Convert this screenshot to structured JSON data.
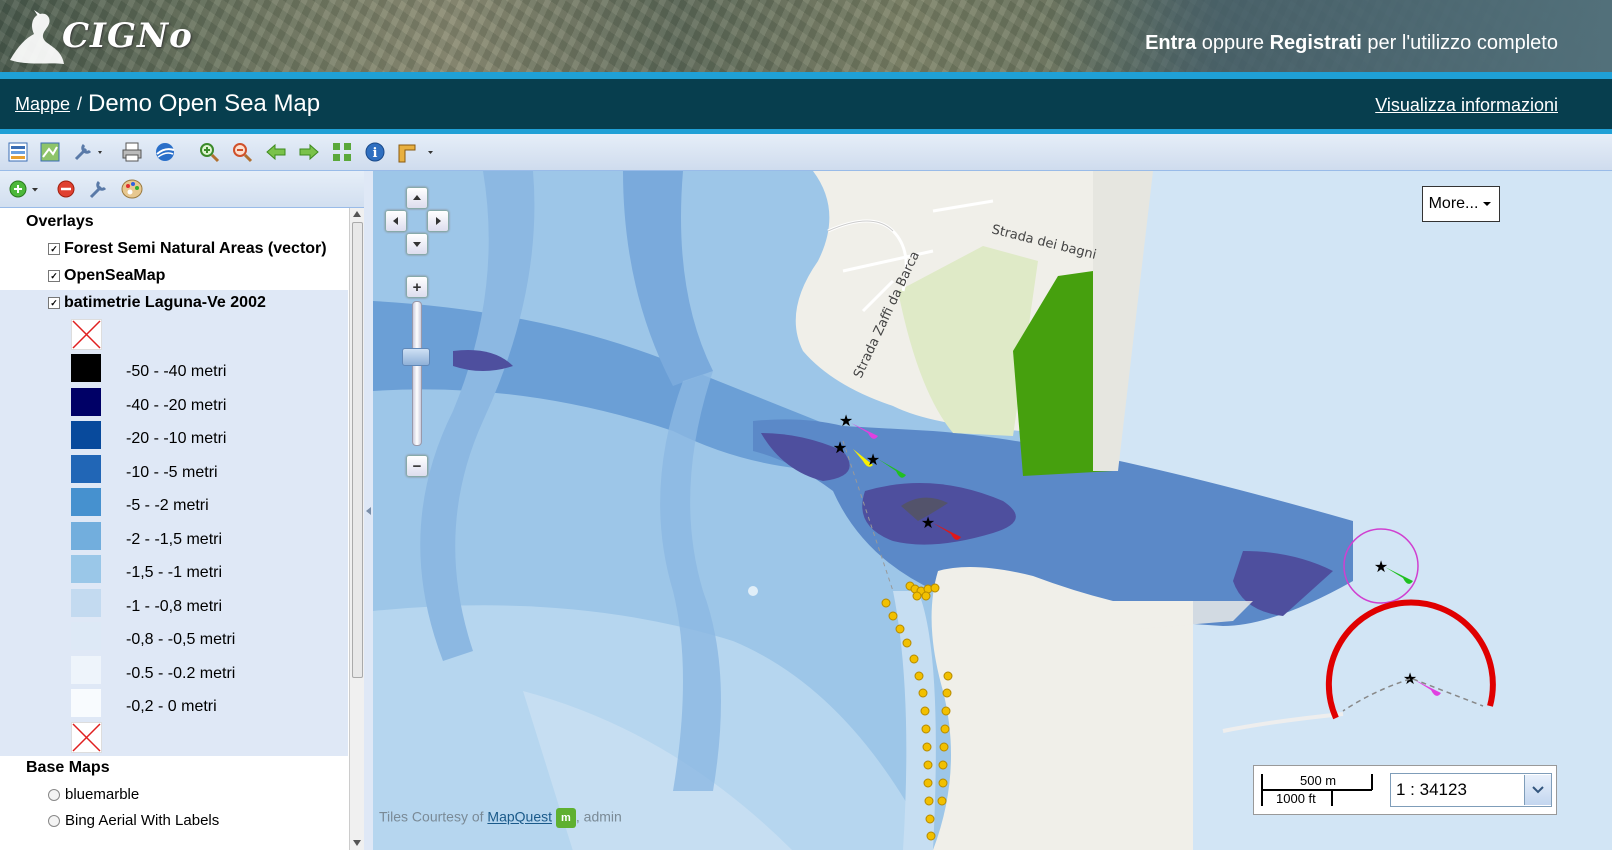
{
  "header": {
    "logo_text": "CIGNo",
    "auth_login": "Entra",
    "auth_or": "oppure",
    "auth_register": "Registrati",
    "auth_suffix": "per l'utilizzo completo"
  },
  "titlebar": {
    "breadcrumb_link": "Mappe",
    "breadcrumb_sep": "/",
    "page_title": "Demo Open Sea Map",
    "info_link": "Visualizza informazioni"
  },
  "toolbar": {
    "icons": [
      "layer-properties-icon",
      "map-publish-icon",
      "tools-dropdown-icon",
      "print-icon",
      "google-earth-icon",
      "zoom-in-icon",
      "zoom-out-icon",
      "back-arrow-icon",
      "forward-arrow-icon",
      "zoom-extent-icon",
      "info-icon",
      "measure-dropdown-icon"
    ]
  },
  "layer_panel": {
    "toolbar_icons": [
      "add-layer-icon",
      "remove-layer-icon",
      "layer-properties-icon",
      "style-palette-icon"
    ],
    "overlays_title": "Overlays",
    "overlays": [
      {
        "label": "Forest Semi Natural Areas (vector)",
        "checked": true
      },
      {
        "label": "OpenSeaMap",
        "checked": true
      },
      {
        "label": "batimetrie Laguna-Ve 2002",
        "checked": true
      }
    ],
    "legend": [
      {
        "label": "-50 - -40 metri",
        "color": "#000000"
      },
      {
        "label": "-40 - -20 metri",
        "color": "#000066"
      },
      {
        "label": "-20 - -10 metri",
        "color": "#084a9c"
      },
      {
        "label": "-10 - -5 metri",
        "color": "#2166b6"
      },
      {
        "label": "-5 - -2 metri",
        "color": "#4691cf"
      },
      {
        "label": "-2 - -1,5 metri",
        "color": "#72aedd"
      },
      {
        "label": "-1,5 - -1 metri",
        "color": "#9ac7e8"
      },
      {
        "label": "-1 - -0,8 metri",
        "color": "#c3daf0"
      },
      {
        "label": "-0,8 - -0,5 metri",
        "color": "#dde9f6"
      },
      {
        "label": "-0.5 - -0.2 metri",
        "color": "#eef4fb"
      },
      {
        "label": "-0,2 - 0 metri",
        "color": "#f8fbfe"
      }
    ],
    "basemaps_title": "Base Maps",
    "basemaps": [
      "bluemarble",
      "Bing Aerial With Labels"
    ]
  },
  "map": {
    "more_button": "More...",
    "street_label_1": "Strada dei bagni",
    "street_label_2": "Strada Zaffi da Barca",
    "scale_m": "500 m",
    "scale_ft": "1000 ft",
    "scale_value": "1 : 34123",
    "attribution_prefix": "Tiles Courtesy of",
    "attribution_link": "MapQuest",
    "attribution_suffix": ", admin",
    "colors": {
      "sea": "#b8d6ee",
      "open_sea": "#d2e5f5",
      "deep_channel": "#5b89c8",
      "deep_hole": "#4e4f9e",
      "land": "#f0efe9",
      "park": "#dfeac7",
      "forest": "#46a00e",
      "vessel_track": "#f2c000",
      "range_circle": "#e00000",
      "magenta": "#e040e0"
    }
  }
}
